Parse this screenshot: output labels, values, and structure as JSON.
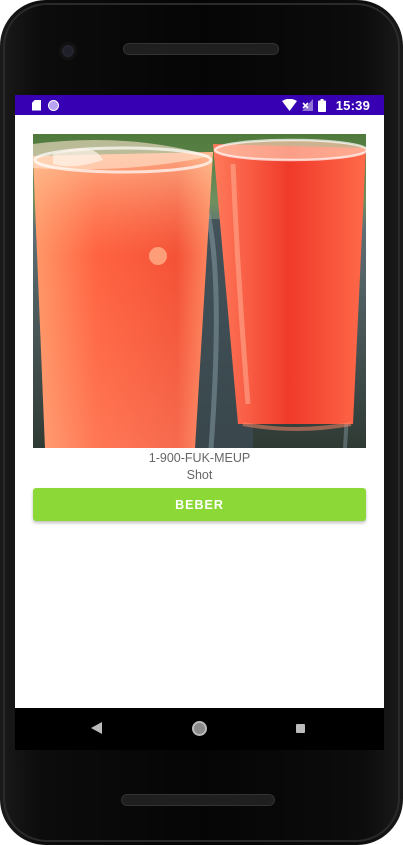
{
  "status_bar": {
    "time": "15:39",
    "icons": [
      "sd-card-icon",
      "circle-icon",
      "wifi-icon",
      "signal-icon",
      "battery-icon"
    ],
    "background": "#3700b3"
  },
  "card": {
    "image_icon": "drinks-photo",
    "number": "1-900-FUK-MEUP",
    "label": "Shot",
    "button_label": "BEBER",
    "button_color": "#8bd837"
  },
  "nav_bar": {
    "icons": [
      "back-icon",
      "home-icon",
      "recents-icon"
    ]
  }
}
